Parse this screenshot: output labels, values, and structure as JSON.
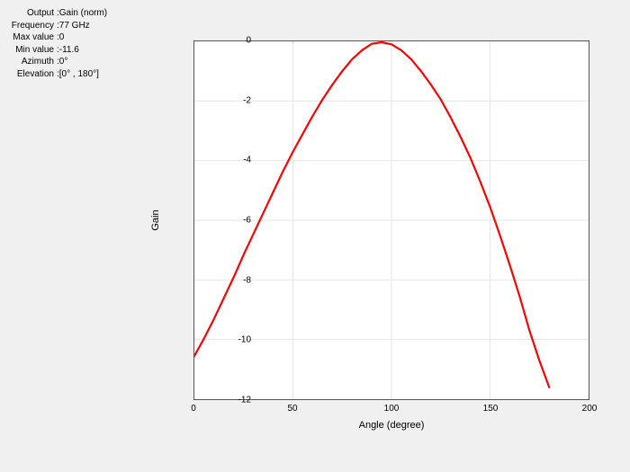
{
  "info": {
    "output_label": "Output",
    "output_value": "Gain (norm)",
    "frequency_label": "Frequency",
    "frequency_value": "77 GHz",
    "max_label": "Max value",
    "max_value": "0",
    "min_label": "Min value",
    "min_value": "-11.6",
    "azimuth_label": "Azimuth",
    "azimuth_value": "0°",
    "elevation_label": "Elevation",
    "elevation_value": "[0° , 180°]"
  },
  "axes": {
    "xlabel": "Angle (degree)",
    "ylabel": "Gain",
    "xticks": [
      "0",
      "50",
      "100",
      "150",
      "200"
    ],
    "yticks": [
      "0",
      "-2",
      "-4",
      "-6",
      "-8",
      "-10",
      "-12"
    ]
  },
  "chart_data": {
    "type": "line",
    "title": "",
    "xlabel": "Angle (degree)",
    "ylabel": "Gain",
    "xlim": [
      0,
      200
    ],
    "ylim": [
      -12,
      0
    ],
    "series": [
      {
        "name": "Gain (norm)",
        "color": "#ff0000",
        "x": [
          0,
          5,
          10,
          15,
          20,
          25,
          30,
          35,
          40,
          45,
          50,
          55,
          60,
          65,
          70,
          75,
          80,
          85,
          90,
          95,
          100,
          105,
          110,
          115,
          120,
          125,
          130,
          135,
          140,
          145,
          150,
          155,
          160,
          165,
          170,
          175,
          180
        ],
        "values": [
          -10.55,
          -9.95,
          -9.3,
          -8.6,
          -7.9,
          -7.15,
          -6.45,
          -5.75,
          -5.05,
          -4.35,
          -3.7,
          -3.1,
          -2.5,
          -1.95,
          -1.45,
          -1.0,
          -0.6,
          -0.3,
          -0.08,
          -0.03,
          -0.1,
          -0.3,
          -0.6,
          -1.0,
          -1.45,
          -1.95,
          -2.55,
          -3.2,
          -3.9,
          -4.7,
          -5.55,
          -6.5,
          -7.5,
          -8.55,
          -9.7,
          -10.7,
          -11.6
        ]
      }
    ]
  }
}
